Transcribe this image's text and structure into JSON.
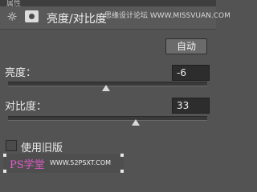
{
  "header": {
    "tab_title": "属性",
    "panel_title": "亮度/对比度",
    "adjustment_icon": "sun-icon",
    "mask_icon": "layer-mask-icon",
    "watermark": "思缘设计论坛 WWW.MISSVUAN.COM"
  },
  "auto_button": {
    "label": "自动"
  },
  "brightness": {
    "label": "亮度：",
    "value": "-6",
    "slider_fraction": 0.49
  },
  "contrast": {
    "label": "对比度：",
    "value": "33",
    "slider_fraction": 0.64
  },
  "legacy": {
    "label": "使用旧版",
    "checked": false
  },
  "logo": {
    "text": "PS学堂",
    "url": "WWW.52PSXT.COM"
  }
}
